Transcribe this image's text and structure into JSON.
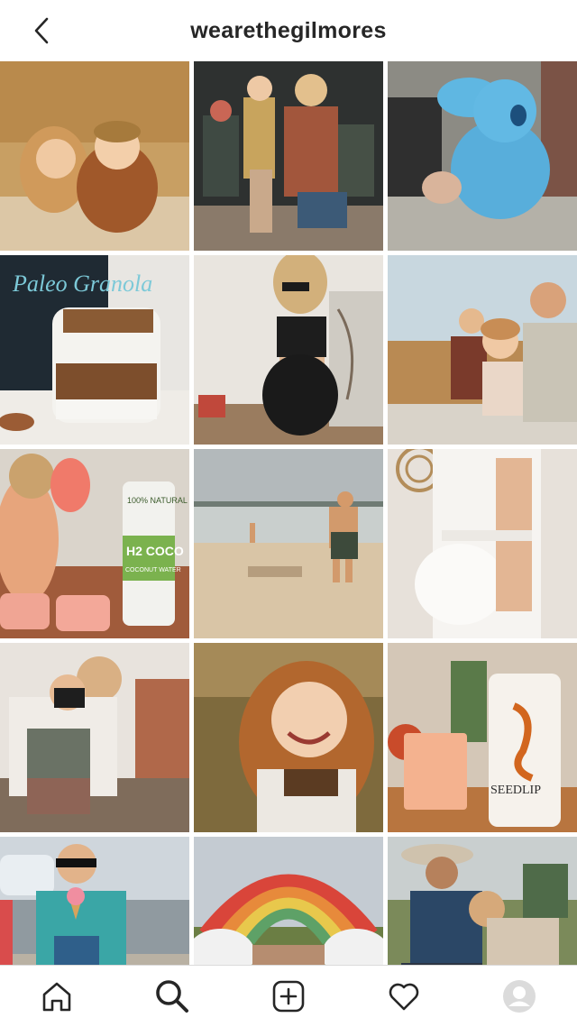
{
  "header": {
    "title": "wearethegilmores"
  },
  "grid": {
    "tiles": [
      {
        "name": "post-kids-hugging-field"
      },
      {
        "name": "post-mother-child-porch"
      },
      {
        "name": "post-blue-plush-toy"
      },
      {
        "name": "post-paleo-granola-jar",
        "text": "Paleo Granola"
      },
      {
        "name": "post-pregnant-mirror-selfie"
      },
      {
        "name": "post-family-blanket"
      },
      {
        "name": "post-coconut-water-popsicles",
        "text_brand": "H2 COCO",
        "text_sub": "COCONUT WATER",
        "text_nat": "100% NATURAL"
      },
      {
        "name": "post-child-at-beach"
      },
      {
        "name": "post-pregnant-white-dress"
      },
      {
        "name": "post-kids-with-camera"
      },
      {
        "name": "post-smiling-girl-portrait"
      },
      {
        "name": "post-seedlip-drink",
        "text": "SEEDLIP"
      },
      {
        "name": "post-boy-ice-cream"
      },
      {
        "name": "post-rainbow-balloon"
      },
      {
        "name": "post-father-son-grass"
      }
    ]
  },
  "tabbar": {
    "icons": [
      "home-icon",
      "search-icon",
      "new-post-icon",
      "activity-heart-icon",
      "profile-avatar-icon"
    ],
    "active": "search-icon"
  }
}
